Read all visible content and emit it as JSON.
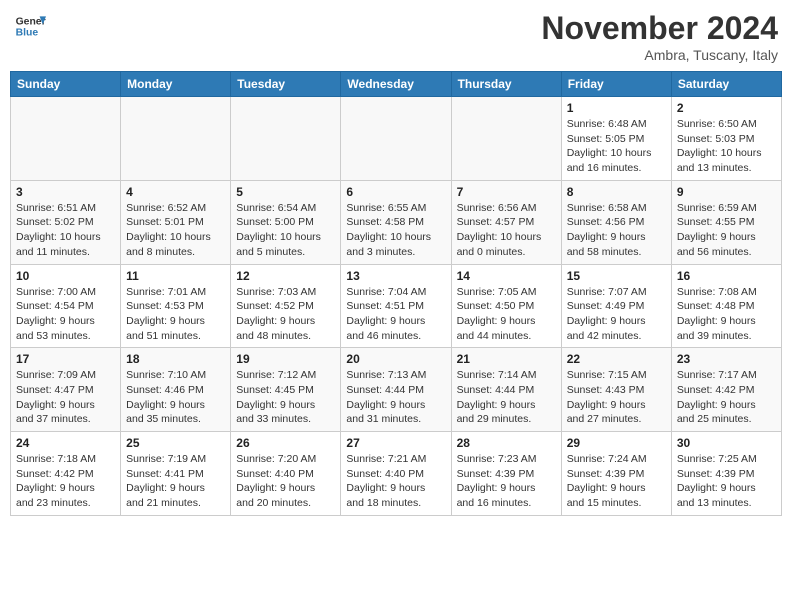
{
  "logo": {
    "line1": "General",
    "line2": "Blue"
  },
  "header": {
    "month": "November 2024",
    "location": "Ambra, Tuscany, Italy"
  },
  "weekdays": [
    "Sunday",
    "Monday",
    "Tuesday",
    "Wednesday",
    "Thursday",
    "Friday",
    "Saturday"
  ],
  "weeks": [
    [
      {
        "day": "",
        "info": ""
      },
      {
        "day": "",
        "info": ""
      },
      {
        "day": "",
        "info": ""
      },
      {
        "day": "",
        "info": ""
      },
      {
        "day": "",
        "info": ""
      },
      {
        "day": "1",
        "info": "Sunrise: 6:48 AM\nSunset: 5:05 PM\nDaylight: 10 hours\nand 16 minutes."
      },
      {
        "day": "2",
        "info": "Sunrise: 6:50 AM\nSunset: 5:03 PM\nDaylight: 10 hours\nand 13 minutes."
      }
    ],
    [
      {
        "day": "3",
        "info": "Sunrise: 6:51 AM\nSunset: 5:02 PM\nDaylight: 10 hours\nand 11 minutes."
      },
      {
        "day": "4",
        "info": "Sunrise: 6:52 AM\nSunset: 5:01 PM\nDaylight: 10 hours\nand 8 minutes."
      },
      {
        "day": "5",
        "info": "Sunrise: 6:54 AM\nSunset: 5:00 PM\nDaylight: 10 hours\nand 5 minutes."
      },
      {
        "day": "6",
        "info": "Sunrise: 6:55 AM\nSunset: 4:58 PM\nDaylight: 10 hours\nand 3 minutes."
      },
      {
        "day": "7",
        "info": "Sunrise: 6:56 AM\nSunset: 4:57 PM\nDaylight: 10 hours\nand 0 minutes."
      },
      {
        "day": "8",
        "info": "Sunrise: 6:58 AM\nSunset: 4:56 PM\nDaylight: 9 hours\nand 58 minutes."
      },
      {
        "day": "9",
        "info": "Sunrise: 6:59 AM\nSunset: 4:55 PM\nDaylight: 9 hours\nand 56 minutes."
      }
    ],
    [
      {
        "day": "10",
        "info": "Sunrise: 7:00 AM\nSunset: 4:54 PM\nDaylight: 9 hours\nand 53 minutes."
      },
      {
        "day": "11",
        "info": "Sunrise: 7:01 AM\nSunset: 4:53 PM\nDaylight: 9 hours\nand 51 minutes."
      },
      {
        "day": "12",
        "info": "Sunrise: 7:03 AM\nSunset: 4:52 PM\nDaylight: 9 hours\nand 48 minutes."
      },
      {
        "day": "13",
        "info": "Sunrise: 7:04 AM\nSunset: 4:51 PM\nDaylight: 9 hours\nand 46 minutes."
      },
      {
        "day": "14",
        "info": "Sunrise: 7:05 AM\nSunset: 4:50 PM\nDaylight: 9 hours\nand 44 minutes."
      },
      {
        "day": "15",
        "info": "Sunrise: 7:07 AM\nSunset: 4:49 PM\nDaylight: 9 hours\nand 42 minutes."
      },
      {
        "day": "16",
        "info": "Sunrise: 7:08 AM\nSunset: 4:48 PM\nDaylight: 9 hours\nand 39 minutes."
      }
    ],
    [
      {
        "day": "17",
        "info": "Sunrise: 7:09 AM\nSunset: 4:47 PM\nDaylight: 9 hours\nand 37 minutes."
      },
      {
        "day": "18",
        "info": "Sunrise: 7:10 AM\nSunset: 4:46 PM\nDaylight: 9 hours\nand 35 minutes."
      },
      {
        "day": "19",
        "info": "Sunrise: 7:12 AM\nSunset: 4:45 PM\nDaylight: 9 hours\nand 33 minutes."
      },
      {
        "day": "20",
        "info": "Sunrise: 7:13 AM\nSunset: 4:44 PM\nDaylight: 9 hours\nand 31 minutes."
      },
      {
        "day": "21",
        "info": "Sunrise: 7:14 AM\nSunset: 4:44 PM\nDaylight: 9 hours\nand 29 minutes."
      },
      {
        "day": "22",
        "info": "Sunrise: 7:15 AM\nSunset: 4:43 PM\nDaylight: 9 hours\nand 27 minutes."
      },
      {
        "day": "23",
        "info": "Sunrise: 7:17 AM\nSunset: 4:42 PM\nDaylight: 9 hours\nand 25 minutes."
      }
    ],
    [
      {
        "day": "24",
        "info": "Sunrise: 7:18 AM\nSunset: 4:42 PM\nDaylight: 9 hours\nand 23 minutes."
      },
      {
        "day": "25",
        "info": "Sunrise: 7:19 AM\nSunset: 4:41 PM\nDaylight: 9 hours\nand 21 minutes."
      },
      {
        "day": "26",
        "info": "Sunrise: 7:20 AM\nSunset: 4:40 PM\nDaylight: 9 hours\nand 20 minutes."
      },
      {
        "day": "27",
        "info": "Sunrise: 7:21 AM\nSunset: 4:40 PM\nDaylight: 9 hours\nand 18 minutes."
      },
      {
        "day": "28",
        "info": "Sunrise: 7:23 AM\nSunset: 4:39 PM\nDaylight: 9 hours\nand 16 minutes."
      },
      {
        "day": "29",
        "info": "Sunrise: 7:24 AM\nSunset: 4:39 PM\nDaylight: 9 hours\nand 15 minutes."
      },
      {
        "day": "30",
        "info": "Sunrise: 7:25 AM\nSunset: 4:39 PM\nDaylight: 9 hours\nand 13 minutes."
      }
    ]
  ]
}
